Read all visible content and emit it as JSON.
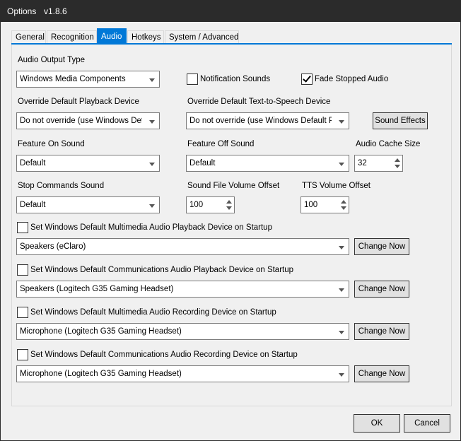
{
  "window": {
    "title": "Options",
    "version": "v1.8.6"
  },
  "tabs": [
    {
      "label": "General"
    },
    {
      "label": "Recognition"
    },
    {
      "label": "Audio",
      "active": true
    },
    {
      "label": "Hotkeys"
    },
    {
      "label": "System / Advanced"
    }
  ],
  "audio": {
    "output_type": {
      "label": "Audio Output Type",
      "value": "Windows Media Components"
    },
    "notification_sounds": {
      "label": "Notification Sounds",
      "checked": false
    },
    "fade_stopped_audio": {
      "label": "Fade Stopped Audio",
      "checked": true
    },
    "override_playback": {
      "label": "Override Default Playback Device",
      "value": "Do not override (use Windows Defa"
    },
    "override_tts": {
      "label": "Override Default Text-to-Speech Device",
      "value": "Do not override (use Windows Default Pl"
    },
    "sound_effects_label": "Sound Effects",
    "feature_on_sound": {
      "label": "Feature On Sound",
      "value": "Default"
    },
    "feature_off_sound": {
      "label": "Feature Off Sound",
      "value": "Default"
    },
    "audio_cache_size": {
      "label": "Audio Cache Size",
      "value": "32"
    },
    "stop_commands_sound": {
      "label": "Stop Commands Sound",
      "value": "Default"
    },
    "sound_file_volume_offset": {
      "label": "Sound File Volume Offset",
      "value": "100"
    },
    "tts_volume_offset": {
      "label": "TTS Volume Offset",
      "value": "100"
    },
    "device_sections": [
      {
        "label": "Set Windows Default Multimedia Audio Playback Device on Startup",
        "checked": false,
        "device": "Speakers (eClaro)",
        "button": "Change Now"
      },
      {
        "label": "Set Windows Default Communications Audio Playback Device on Startup",
        "checked": false,
        "device": "Speakers (Logitech G35 Gaming Headset)",
        "button": "Change Now"
      },
      {
        "label": "Set Windows Default Multimedia Audio Recording Device on Startup",
        "checked": false,
        "device": "Microphone (Logitech G35 Gaming Headset)",
        "button": "Change Now"
      },
      {
        "label": "Set Windows Default Communications Audio Recording Device on Startup",
        "checked": false,
        "device": "Microphone (Logitech G35 Gaming Headset)",
        "button": "Change Now"
      }
    ]
  },
  "footer": {
    "ok_label": "OK",
    "cancel_label": "Cancel"
  },
  "colors": {
    "accent": "#0078d7",
    "titlebar": "#2b2b2b",
    "background": "#f0f0f0"
  }
}
